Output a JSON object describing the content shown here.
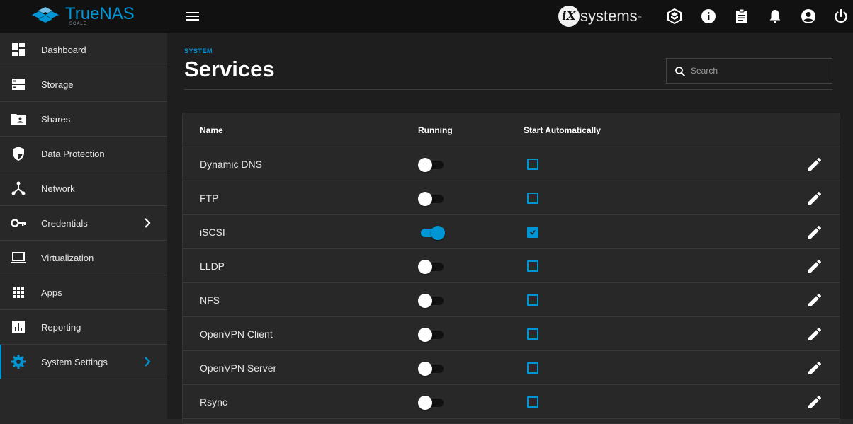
{
  "brand": {
    "name": "TrueNAS",
    "edition": "SCALE"
  },
  "vendor": {
    "badge": "iX",
    "word": "systems",
    "trademark": "™"
  },
  "sidebar": {
    "items": [
      {
        "label": "Dashboard",
        "icon": "dashboard-icon"
      },
      {
        "label": "Storage",
        "icon": "storage-icon"
      },
      {
        "label": "Shares",
        "icon": "shares-folder-icon"
      },
      {
        "label": "Data Protection",
        "icon": "shield-icon"
      },
      {
        "label": "Network",
        "icon": "network-icon"
      },
      {
        "label": "Credentials",
        "icon": "key-icon",
        "has_submenu": true
      },
      {
        "label": "Virtualization",
        "icon": "laptop-icon"
      },
      {
        "label": "Apps",
        "icon": "apps-grid-icon"
      },
      {
        "label": "Reporting",
        "icon": "bar-chart-icon"
      },
      {
        "label": "System Settings",
        "icon": "gear-icon",
        "has_submenu": true,
        "active": true
      }
    ]
  },
  "header": {
    "breadcrumb": "SYSTEM",
    "title": "Services"
  },
  "search": {
    "placeholder": "Search",
    "value": ""
  },
  "table": {
    "columns": {
      "name": "Name",
      "running": "Running",
      "start_auto": "Start Automatically"
    },
    "rows": [
      {
        "name": "Dynamic DNS",
        "running": false,
        "start_auto": false
      },
      {
        "name": "FTP",
        "running": false,
        "start_auto": false
      },
      {
        "name": "iSCSI",
        "running": true,
        "start_auto": true
      },
      {
        "name": "LLDP",
        "running": false,
        "start_auto": false
      },
      {
        "name": "NFS",
        "running": false,
        "start_auto": false
      },
      {
        "name": "OpenVPN Client",
        "running": false,
        "start_auto": false
      },
      {
        "name": "OpenVPN Server",
        "running": false,
        "start_auto": false
      },
      {
        "name": "Rsync",
        "running": false,
        "start_auto": false
      }
    ]
  },
  "colors": {
    "accent": "#0095d5",
    "topbar": "#111111",
    "sidebar": "#282828",
    "content": "#1e1e1e",
    "card": "#282828"
  }
}
